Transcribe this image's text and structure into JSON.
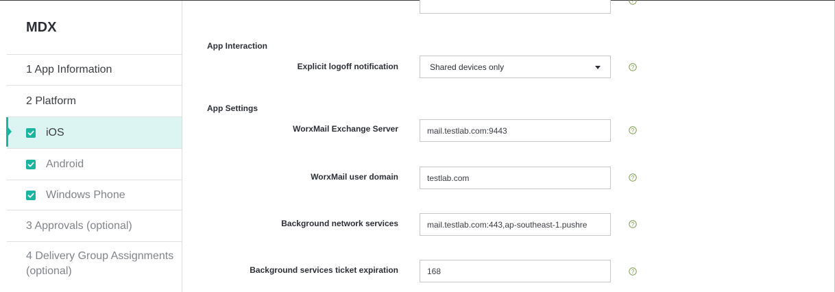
{
  "sidebar": {
    "title": "MDX",
    "items": [
      {
        "label": "1 App Information"
      },
      {
        "label": "2 Platform"
      },
      {
        "label": "iOS",
        "checked": true
      },
      {
        "label": "Android",
        "checked": true
      },
      {
        "label": "Windows Phone",
        "checked": true
      },
      {
        "label": "3 Approvals (optional)"
      },
      {
        "label": "4 Delivery Group Assignments (optional)"
      }
    ],
    "selected_item": "iOS"
  },
  "main": {
    "app_interaction": {
      "heading": "App Interaction",
      "logoff_label": "Explicit logoff notification",
      "logoff_value": "Shared devices only"
    },
    "app_settings": {
      "heading": "App Settings",
      "fields": [
        {
          "label": "WorxMail Exchange Server",
          "value": "mail.testlab.com:9443"
        },
        {
          "label": "WorxMail user domain",
          "value": "testlab.com"
        },
        {
          "label": "Background network services",
          "value": "mail.testlab.com:443,ap-southeast-1.pushre"
        },
        {
          "label": "Background services ticket expiration",
          "value": "168"
        }
      ]
    }
  },
  "colors": {
    "accent": "#1ab4a0",
    "selected_bg": "#dcf4f2",
    "help_icon": "#7a9a4a"
  },
  "icons": {
    "help": "help-circle-icon",
    "check": "checkbox-checked-icon",
    "dropdown": "caret-down-icon"
  }
}
